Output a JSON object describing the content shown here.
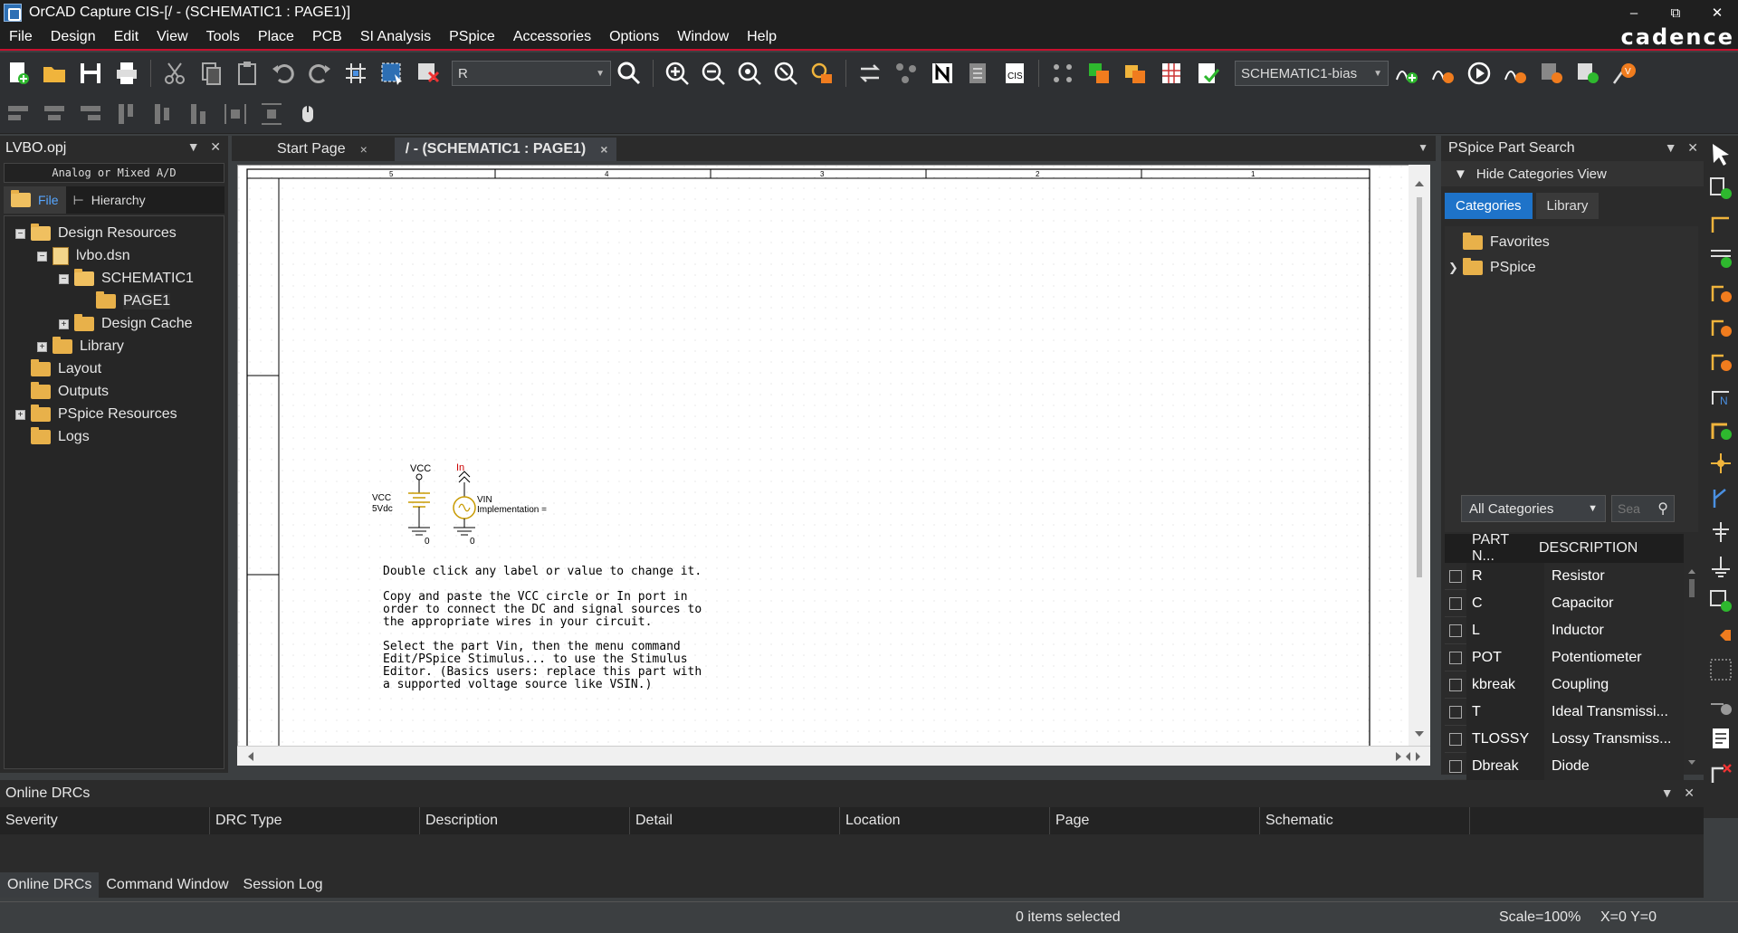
{
  "window": {
    "title": "OrCAD Capture CIS-[/ - (SCHEMATIC1 : PAGE1)]",
    "controls": [
      "–",
      "⧉",
      "✕"
    ]
  },
  "menu": {
    "items": [
      "File",
      "Design",
      "Edit",
      "View",
      "Tools",
      "Place",
      "PCB",
      "SI Analysis",
      "PSpice",
      "Accessories",
      "Options",
      "Window",
      "Help"
    ],
    "brand": "cadence"
  },
  "toolbar": {
    "search_value": "R",
    "profile_value": "SCHEMATIC1-bias"
  },
  "project": {
    "title": "LVBO.opj",
    "subtitle": "Analog or Mixed A/D",
    "tabs": [
      "File",
      "Hierarchy"
    ],
    "tree": [
      {
        "label": "Design Resources"
      },
      {
        "label": "lvbo.dsn"
      },
      {
        "label": "SCHEMATIC1"
      },
      {
        "label": "PAGE1"
      },
      {
        "label": "Design Cache"
      },
      {
        "label": "Library"
      },
      {
        "label": "Layout"
      },
      {
        "label": "Outputs"
      },
      {
        "label": "PSpice Resources"
      },
      {
        "label": "Logs"
      }
    ]
  },
  "doc_tabs": {
    "start_page": "Start Page",
    "active": "/ - (SCHEMATIC1 : PAGE1)",
    "close": "×"
  },
  "schematic": {
    "border_numbers": [
      "5",
      "4",
      "3",
      "2",
      "1"
    ],
    "vcc_top": "VCC",
    "vcc_name": "VCC",
    "vcc_value": "5Vdc",
    "in_port": "In",
    "vin_name": "VIN",
    "vin_impl": "Implementation =",
    "ground1": "0",
    "ground2": "0",
    "note1": "Double click any label or value to change it.",
    "note2": "Copy and paste the VCC circle or In port in\norder to connect the DC and signal sources to\nthe appropriate wires in your circuit.",
    "note3": "Select the part Vin, then the menu command\nEdit/PSpice Stimulus... to use the Stimulus\nEditor. (Basics users: replace this part with\na supported voltage source like VSIN.)"
  },
  "part_search": {
    "title": "PSpice Part Search",
    "hide_categories": "Hide Categories View",
    "tabs": [
      "Categories",
      "Library"
    ],
    "categories": [
      "Favorites",
      "PSpice"
    ],
    "filter": "All Categories",
    "search_placeholder": "Sea",
    "columns": [
      "PART N...",
      "DESCRIPTION"
    ],
    "parts": [
      {
        "name": "R",
        "desc": "Resistor"
      },
      {
        "name": "C",
        "desc": "Capacitor"
      },
      {
        "name": "L",
        "desc": "Inductor"
      },
      {
        "name": "POT",
        "desc": "Potentiometer"
      },
      {
        "name": "kbreak",
        "desc": "Coupling"
      },
      {
        "name": "T",
        "desc": "Ideal Transmissi..."
      },
      {
        "name": "TLOSSY",
        "desc": "Lossy Transmiss..."
      },
      {
        "name": "Dbreak",
        "desc": "Diode"
      }
    ]
  },
  "drc": {
    "title": "Online DRCs",
    "columns": [
      "Severity",
      "DRC Type",
      "Description",
      "Detail",
      "Location",
      "Page",
      "Schematic"
    ],
    "tabs": [
      "Online DRCs",
      "Command Window",
      "Session Log"
    ]
  },
  "status": {
    "selection": "0 items selected",
    "scale": "Scale=100%",
    "coords": "X=0  Y=0"
  },
  "colors": {
    "accent_red": "#c8102e",
    "tab_blue": "#1e73c9",
    "net_red": "#cc0000"
  }
}
